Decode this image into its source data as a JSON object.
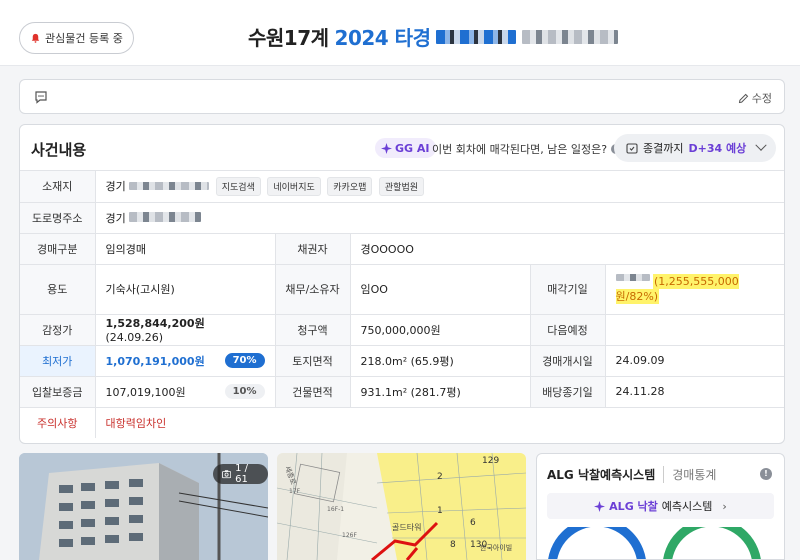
{
  "header": {
    "watch_label": "관심물건 등록 중",
    "case_prefix": "수원17계",
    "case_year_type": "2024 타경"
  },
  "memo": {
    "edit_label": "수정"
  },
  "case": {
    "title": "사건내용",
    "ai_badge": "GG AI",
    "ai_question": "이번 회차에 매각된다면, 남은 일정은?",
    "expect_prefix": "종결까지",
    "expect_value": "D+34 예상",
    "rows": {
      "location_label": "소재지",
      "location_value": "경기",
      "map_chips": [
        "지도검색",
        "네이버지도",
        "카카오맵",
        "관할법원"
      ],
      "road_label": "도로명주소",
      "road_value": "경기",
      "type_label": "경매구분",
      "type_value": "임의경매",
      "creditor_label": "채권자",
      "creditor_value": "경OOOOO",
      "use_label": "용도",
      "use_value": "기숙사(고시원)",
      "debtor_label": "채무/소유자",
      "debtor_value": "임OO",
      "sale_date_label": "매각기일",
      "sale_date_value": "(1,255,555,000원/82%)",
      "appraisal_label": "감정가",
      "appraisal_value": "1,528,844,200원",
      "appraisal_date": "(24.09.26)",
      "claim_label": "청구액",
      "claim_value": "750,000,000원",
      "next_label": "다음예정",
      "next_value": "",
      "min_label": "최저가",
      "min_value": "1,070,191,000원",
      "min_pct": "70%",
      "land_label": "토지면적",
      "land_value": "218.0m² (65.9평)",
      "start_label": "경매개시일",
      "start_value": "24.09.09",
      "deposit_label": "입찰보증금",
      "deposit_value": "107,019,100원",
      "deposit_pct": "10%",
      "bldg_label": "건물면적",
      "bldg_value": "931.1m² (281.7평)",
      "dividend_label": "배당종기일",
      "dividend_value": "24.11.28",
      "caution_label": "주의사항",
      "caution_value": "대항력임차인"
    }
  },
  "photo": {
    "count": "1 / 61"
  },
  "map": {
    "labels": [
      "129",
      "2",
      "1",
      "6",
      "8",
      "130",
      "17F",
      "16F-1",
      "126F"
    ],
    "place": "골드타워",
    "road": "세종로",
    "place2": "한국아이빌"
  },
  "alg": {
    "title": "ALG 낙찰예측시스템",
    "sub": "경매통계",
    "btn_brand": "ALG 낙찰",
    "btn_rest": "예측시스템"
  },
  "colors": {
    "accent": "#1f6fd1",
    "ai": "#6b3fd6",
    "caution": "#c9302c",
    "highlight": "#fff36a"
  }
}
